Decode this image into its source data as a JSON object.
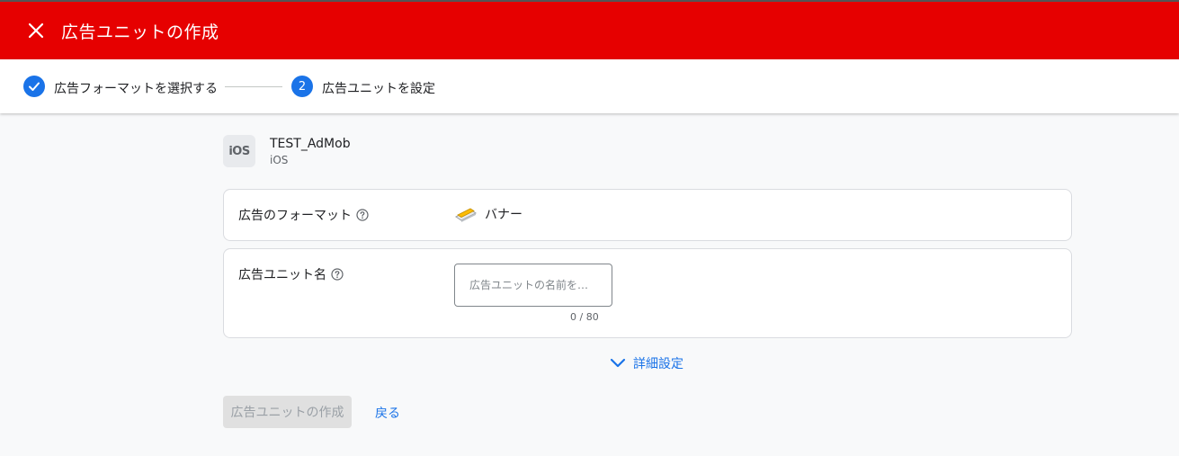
{
  "header": {
    "title": "広告ユニットの作成",
    "background_color": "#e60000",
    "close_icon": "close-icon"
  },
  "stepper": {
    "step1": {
      "label": "広告フォーマットを選択する",
      "state": "completed",
      "icon": "check-icon"
    },
    "step2": {
      "number": "2",
      "label": "広告ユニットを設定",
      "state": "active"
    },
    "accent_color": "#1a73e8"
  },
  "app": {
    "icon_text": "iOS",
    "name": "TEST_AdMob",
    "platform": "iOS"
  },
  "format_card": {
    "label": "広告のフォーマット",
    "value": "バナー",
    "icon": "banner-icon"
  },
  "name_card": {
    "label": "広告ユニット名",
    "placeholder": "広告ユニットの名前を…",
    "value": "",
    "char_count": "0 / 80"
  },
  "advanced": {
    "label": "詳細設定"
  },
  "actions": {
    "create_label": "広告ユニットの作成",
    "back_label": "戻る"
  }
}
